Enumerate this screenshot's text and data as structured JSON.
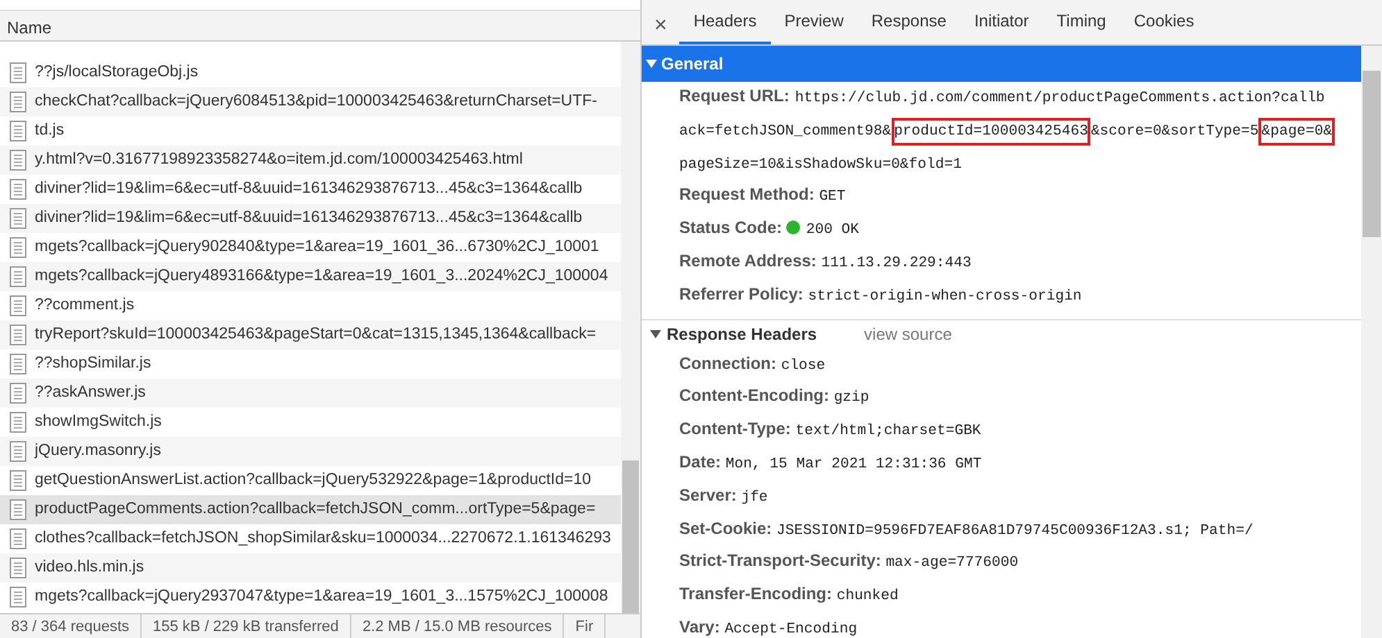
{
  "requests": {
    "column": "Name",
    "rows": [
      {
        "name": "??js/localStorageObj.js",
        "selected": false
      },
      {
        "name": "checkChat?callback=jQuery6084513&pid=100003425463&returnCharset=UTF-",
        "selected": false
      },
      {
        "name": "td.js",
        "selected": false
      },
      {
        "name": "y.html?v=0.31677198923358274&o=item.jd.com/100003425463.html",
        "selected": false
      },
      {
        "name": "diviner?lid=19&lim=6&ec=utf-8&uuid=161346293876713...45&c3=1364&callb",
        "selected": false
      },
      {
        "name": "diviner?lid=19&lim=6&ec=utf-8&uuid=161346293876713...45&c3=1364&callb",
        "selected": false
      },
      {
        "name": "mgets?callback=jQuery902840&type=1&area=19_1601_36...6730%2CJ_10001",
        "selected": false
      },
      {
        "name": "mgets?callback=jQuery4893166&type=1&area=19_1601_3...2024%2CJ_100004",
        "selected": false
      },
      {
        "name": "??comment.js",
        "selected": false
      },
      {
        "name": "tryReport?skuId=100003425463&pageStart=0&cat=1315,1345,1364&callback=",
        "selected": false
      },
      {
        "name": "??shopSimilar.js",
        "selected": false
      },
      {
        "name": "??askAnswer.js",
        "selected": false
      },
      {
        "name": "showImgSwitch.js",
        "selected": false
      },
      {
        "name": "jQuery.masonry.js",
        "selected": false
      },
      {
        "name": "getQuestionAnswerList.action?callback=jQuery532922&page=1&productId=10",
        "selected": false
      },
      {
        "name": "productPageComments.action?callback=fetchJSON_comm...ortType=5&page=",
        "selected": true
      },
      {
        "name": "clothes?callback=fetchJSON_shopSimilar&sku=1000034...2270672.1.161346293",
        "selected": false
      },
      {
        "name": "video.hls.min.js",
        "selected": false
      },
      {
        "name": "mgets?callback=jQuery2937047&type=1&area=19_1601_3...1575%2CJ_100008",
        "selected": false
      }
    ]
  },
  "status_bar": [
    "83 / 364 requests",
    "155 kB / 229 kB transferred",
    "2.2 MB / 15.0 MB resources",
    "Fir"
  ],
  "detail": {
    "close": "×",
    "tabs": [
      {
        "label": "Headers",
        "selected": true
      },
      {
        "label": "Preview",
        "selected": false
      },
      {
        "label": "Response",
        "selected": false
      },
      {
        "label": "Initiator",
        "selected": false
      },
      {
        "label": "Timing",
        "selected": false
      },
      {
        "label": "Cookies",
        "selected": false
      }
    ],
    "general": {
      "title": "General",
      "expanded": true,
      "url_label": "Request URL:",
      "url_lines": [
        [
          {
            "text": "https://club.jd.com/comment/productPageComments.action?callb",
            "highlighted": false
          }
        ],
        [
          {
            "text": "ack=fetchJSON_comment98&",
            "highlighted": false
          },
          {
            "text": "productId=100003425463",
            "highlighted": true
          },
          {
            "text": "&score=0&sortType=5",
            "highlighted": false
          },
          {
            "text": "&page=0&",
            "highlighted": true
          }
        ],
        [
          {
            "text": "pageSize=10&isShadowSku=0&fold=1",
            "highlighted": false
          }
        ]
      ],
      "fields": [
        {
          "label": "Request Method:",
          "value": "GET"
        },
        {
          "label": "Status Code:",
          "value": "200 OK",
          "color": "#2bb52b"
        },
        {
          "label": "Remote Address:",
          "value": "111.13.29.229:443"
        },
        {
          "label": "Referrer Policy:",
          "value": "strict-origin-when-cross-origin"
        }
      ]
    },
    "response_headers": {
      "title": "Response Headers",
      "expanded": true,
      "link": "view source",
      "fields": [
        {
          "label": "Connection:",
          "value": "close"
        },
        {
          "label": "Content-Encoding:",
          "value": "gzip"
        },
        {
          "label": "Content-Type:",
          "value": "text/html;charset=GBK"
        },
        {
          "label": "Date:",
          "value": "Mon, 15 Mar 2021 12:31:36 GMT"
        },
        {
          "label": "Server:",
          "value": "jfe"
        },
        {
          "label": "Set-Cookie:",
          "value": "JSESSIONID=9596FD7EAF86A81D79745C00936F12A3.s1; Path=/"
        },
        {
          "label": "Strict-Transport-Security:",
          "value": "max-age=7776000"
        },
        {
          "label": "Transfer-Encoding:",
          "value": "chunked"
        },
        {
          "label": "Vary:",
          "value": "Accept-Encoding"
        }
      ]
    }
  }
}
